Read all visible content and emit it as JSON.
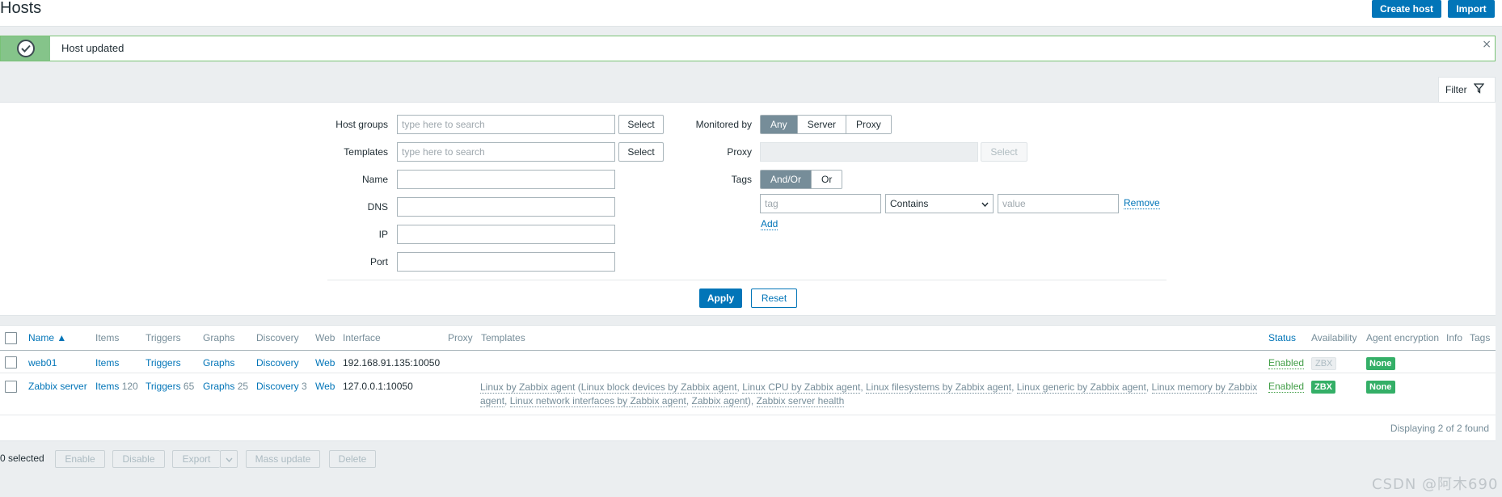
{
  "header": {
    "title": "Hosts",
    "create_host_label": "Create host",
    "import_label": "Import"
  },
  "message": {
    "text": "Host updated",
    "close": "×"
  },
  "filter": {
    "tab_label": "Filter",
    "host_groups_label": "Host groups",
    "host_groups_placeholder": "type here to search",
    "templates_label": "Templates",
    "templates_placeholder": "type here to search",
    "select_label": "Select",
    "name_label": "Name",
    "dns_label": "DNS",
    "ip_label": "IP",
    "port_label": "Port",
    "monitored_by_label": "Monitored by",
    "monitored_by_options": [
      "Any",
      "Server",
      "Proxy"
    ],
    "proxy_label": "Proxy",
    "tags_label": "Tags",
    "tags_options": [
      "And/Or",
      "Or"
    ],
    "tag_placeholder": "tag",
    "tag_operator": "Contains",
    "value_placeholder": "value",
    "remove_label": "Remove",
    "add_label": "Add",
    "apply_label": "Apply",
    "reset_label": "Reset"
  },
  "table": {
    "columns": {
      "name": "Name ▲",
      "items": "Items",
      "triggers": "Triggers",
      "graphs": "Graphs",
      "discovery": "Discovery",
      "web": "Web",
      "interface": "Interface",
      "proxy": "Proxy",
      "templates": "Templates",
      "status": "Status",
      "availability": "Availability",
      "agent_encryption": "Agent encryption",
      "info": "Info",
      "tags": "Tags"
    },
    "rows": [
      {
        "name": "web01",
        "items": "Items",
        "items_count": "",
        "triggers": "Triggers",
        "triggers_count": "",
        "graphs": "Graphs",
        "graphs_count": "",
        "discovery": "Discovery",
        "discovery_count": "",
        "web": "Web",
        "interface": "192.168.91.135:10050",
        "status": "Enabled",
        "availability": "ZBX",
        "encryption": "None"
      },
      {
        "name": "Zabbix server",
        "items": "Items",
        "items_count": "120",
        "triggers": "Triggers",
        "triggers_count": "65",
        "graphs": "Graphs",
        "graphs_count": "25",
        "discovery": "Discovery",
        "discovery_count": "3",
        "web": "Web",
        "interface": "127.0.0.1:10050",
        "templates": {
          "t1": "Linux by Zabbix agent",
          "t2": "Linux block devices by Zabbix agent",
          "t3": "Linux CPU by Zabbix agent",
          "t4": "Linux filesystems by Zabbix agent",
          "t5": "Linux generic by Zabbix agent",
          "t6": "Linux memory by Zabbix agent",
          "t7": "Linux network interfaces by Zabbix agent",
          "t8": "Zabbix agent",
          "t9": "Zabbix server health"
        },
        "status": "Enabled",
        "availability": "ZBX",
        "encryption": "None"
      }
    ],
    "displaying": "Displaying 2 of 2 found"
  },
  "footer": {
    "selected": "0 selected",
    "enable": "Enable",
    "disable": "Disable",
    "export": "Export",
    "mass_update": "Mass update",
    "delete": "Delete"
  },
  "watermark": "CSDN @阿木690",
  "colors": {
    "accent": "#0275b8",
    "success": "#34af67",
    "success_bar": "#85c48a"
  }
}
